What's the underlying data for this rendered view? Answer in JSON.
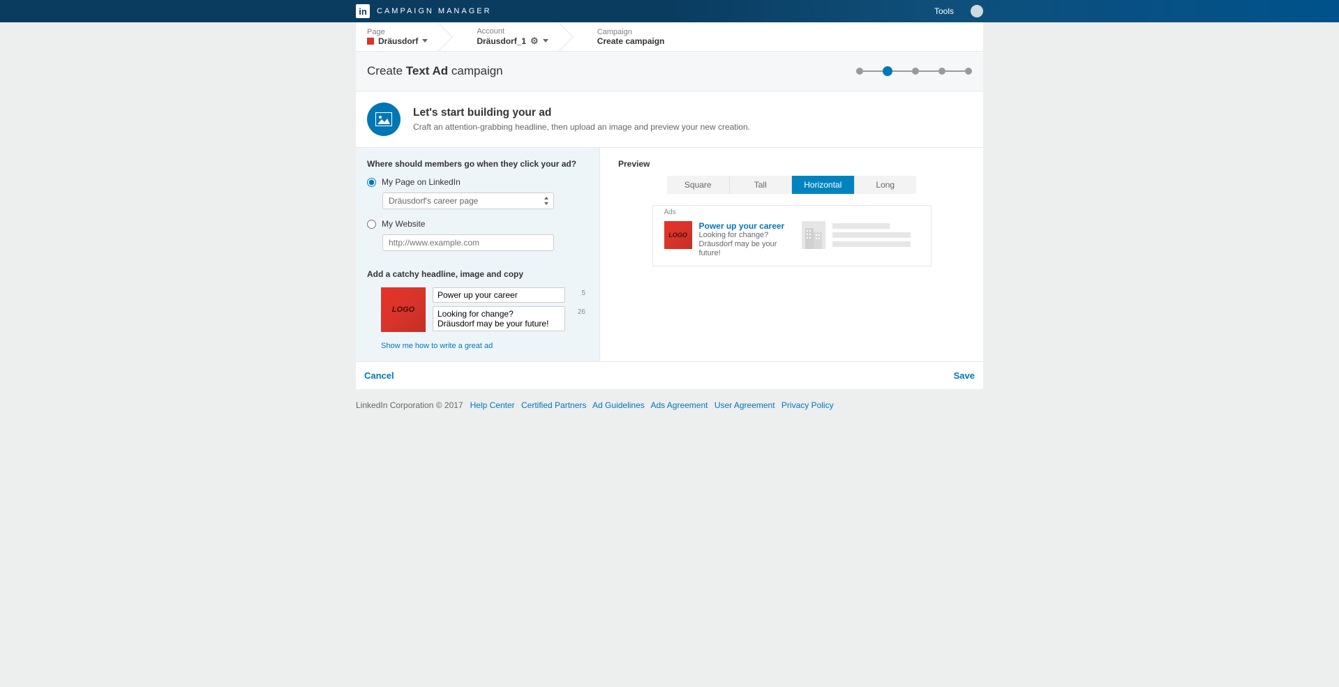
{
  "header": {
    "app_title": "CAMPAIGN MANAGER",
    "logo_text": "in",
    "tools": "Tools"
  },
  "breadcrumb": {
    "page_label": "Page",
    "page_value": "Dräusdorf",
    "account_label": "Account",
    "account_value": "Dräusdorf_1",
    "campaign_label": "Campaign",
    "campaign_value": "Create campaign"
  },
  "title": {
    "pre": "Create ",
    "bold": "Text Ad",
    "post": " campaign"
  },
  "hero": {
    "heading": "Let's start building your ad",
    "sub": "Craft an attention-grabbing headline, then upload an image and preview your new creation."
  },
  "form": {
    "dest_heading": "Where should members go when they click your ad?",
    "radio_page": "My Page on LinkedIn",
    "page_select": "Dräusdorf's career page",
    "radio_site": "My Website",
    "site_placeholder": "http://www.example.com",
    "section2_heading": "Add a catchy headline, image and copy",
    "logo_text": "LOGO",
    "headline_value": "Power up your career",
    "headline_count": "5",
    "copy_value": "Looking for change? Dräusdorf may be your future!",
    "copy_count": "26",
    "help_link": "Show me how to write a great ad"
  },
  "preview": {
    "heading": "Preview",
    "tabs": {
      "square": "Square",
      "tall": "Tall",
      "horizontal": "Horizontal",
      "long": "Long"
    },
    "ads_label": "Ads",
    "logo_text": "LOGO",
    "headline": "Power up your career",
    "copy": "Looking for change? Dräusdorf may be your future!"
  },
  "footer": {
    "cancel": "Cancel",
    "save": "Save"
  },
  "bottom": {
    "copyright": "LinkedIn Corporation © 2017",
    "links": {
      "help": "Help Center",
      "partners": "Certified Partners",
      "guidelines": "Ad Guidelines",
      "ads_agreement": "Ads Agreement",
      "user_agreement": "User Agreement",
      "privacy": "Privacy Policy"
    }
  }
}
